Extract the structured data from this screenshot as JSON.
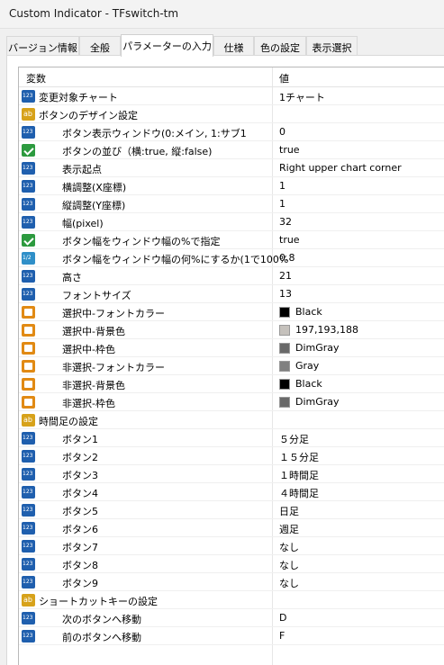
{
  "window": {
    "title": "Custom Indicator - TFswitch-tm"
  },
  "tabs": [
    {
      "label": "バージョン情報"
    },
    {
      "label": "全般"
    },
    {
      "label": "パラメーターの入力"
    },
    {
      "label": "仕様"
    },
    {
      "label": "色の設定"
    },
    {
      "label": "表示選択"
    }
  ],
  "grid": {
    "headers": {
      "variable": "変数",
      "value": "値"
    },
    "rows": [
      {
        "name": "変更対象チャート",
        "value": "1チャート"
      },
      {
        "name": "ボタンのデザイン設定",
        "value": ""
      },
      {
        "name": "ボタン表示ウィンドウ(0:メイン, 1:サブ1",
        "value": "0"
      },
      {
        "name": "ボタンの並び（横:true, 縦:false)",
        "value": "true"
      },
      {
        "name": "表示起点",
        "value": "Right upper chart corner"
      },
      {
        "name": "横調整(X座標)",
        "value": "1"
      },
      {
        "name": "縦調整(Y座標)",
        "value": "1"
      },
      {
        "name": "幅(pixel)",
        "value": "32"
      },
      {
        "name": "ボタン幅をウィンドウ幅の%で指定",
        "value": "true"
      },
      {
        "name": "ボタン幅をウィンドウ幅の何%にするか(1で100%",
        "value": "0.8"
      },
      {
        "name": "高さ",
        "value": "21"
      },
      {
        "name": "フォントサイズ",
        "value": "13"
      },
      {
        "name": "選択中-フォントカラー",
        "value": "Black",
        "color": "#000000"
      },
      {
        "name": "選択中-背景色",
        "value": "197,193,188",
        "color": "#c5c1bc"
      },
      {
        "name": "選択中-枠色",
        "value": "DimGray",
        "color": "#696969"
      },
      {
        "name": "非選択-フォントカラー",
        "value": "Gray",
        "color": "#808080"
      },
      {
        "name": "非選択-背景色",
        "value": "Black",
        "color": "#000000"
      },
      {
        "name": "非選択-枠色",
        "value": "DimGray",
        "color": "#696969"
      },
      {
        "name": "時間足の設定",
        "value": ""
      },
      {
        "name": "ボタン1",
        "value": "５分足"
      },
      {
        "name": "ボタン2",
        "value": "１５分足"
      },
      {
        "name": "ボタン3",
        "value": "１時間足"
      },
      {
        "name": "ボタン4",
        "value": "４時間足"
      },
      {
        "name": "ボタン5",
        "value": "日足"
      },
      {
        "name": "ボタン6",
        "value": "週足"
      },
      {
        "name": "ボタン7",
        "value": "なし"
      },
      {
        "name": "ボタン8",
        "value": "なし"
      },
      {
        "name": "ボタン9",
        "value": "なし"
      },
      {
        "name": "ショートカットキーの設定",
        "value": ""
      },
      {
        "name": "次のボタンへ移動",
        "value": "D"
      },
      {
        "name": "前のボタンへ移動",
        "value": "F"
      }
    ]
  }
}
